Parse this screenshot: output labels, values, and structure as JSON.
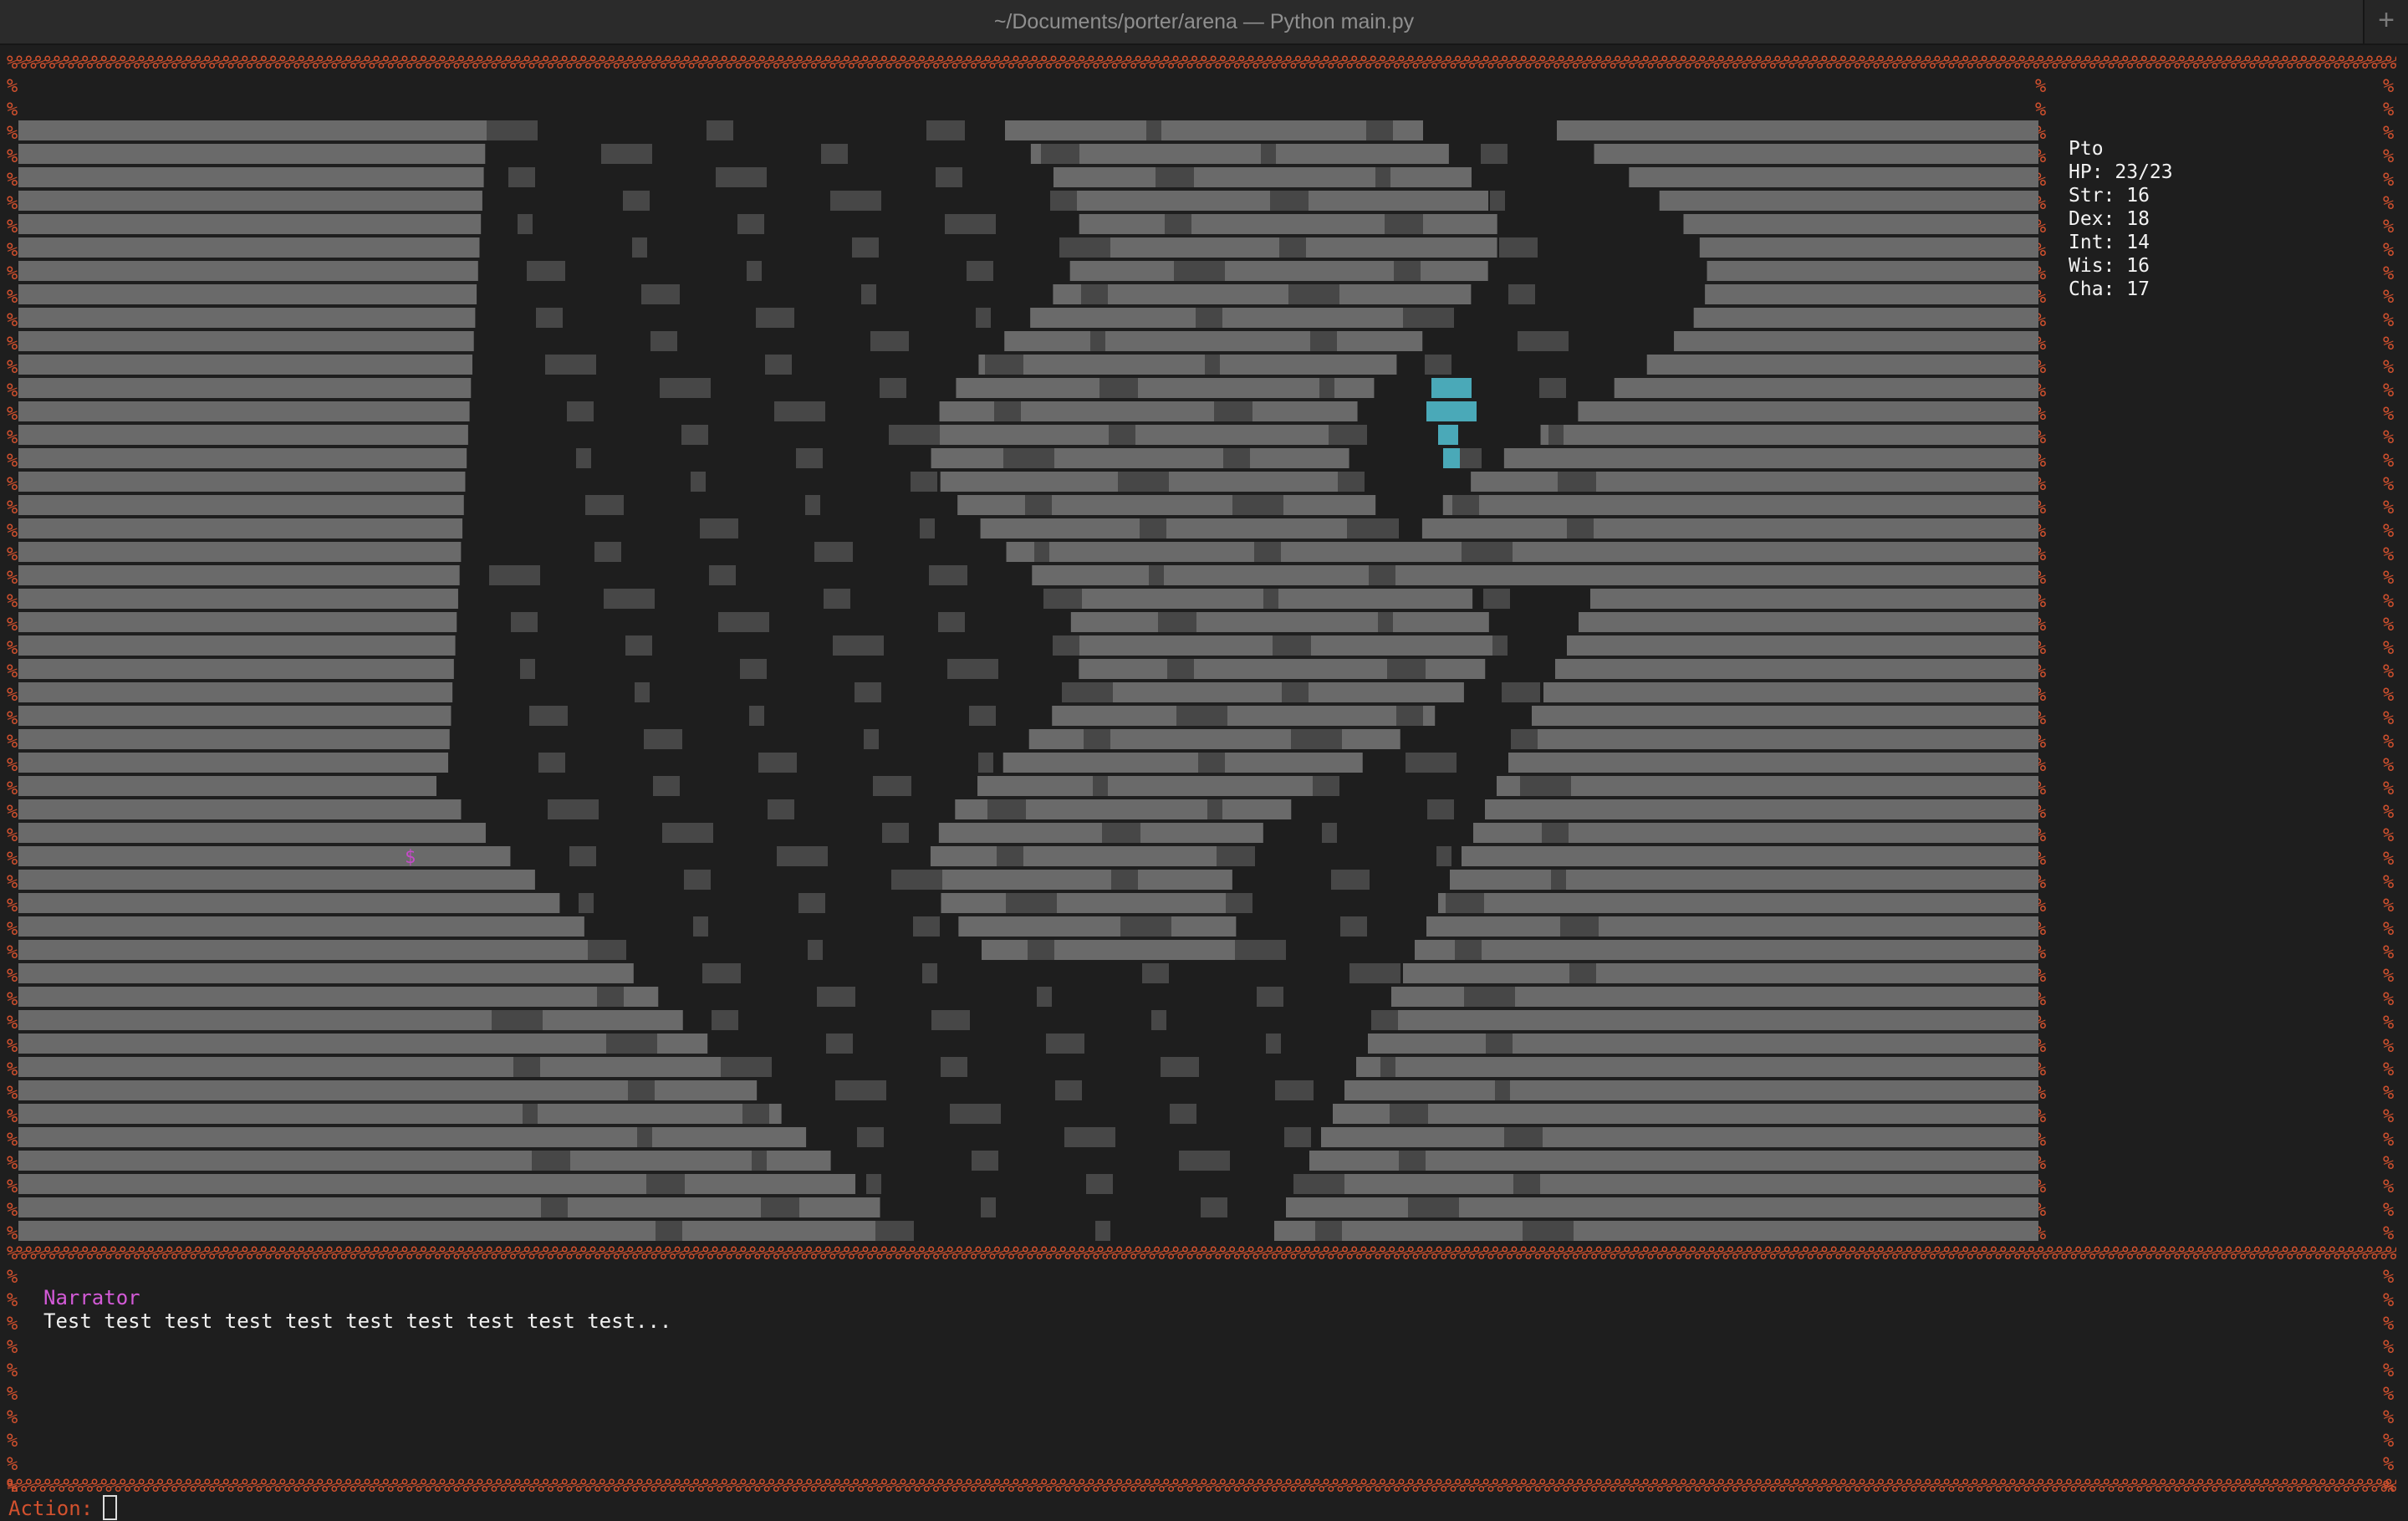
{
  "window": {
    "title": "~/Documents/porter/arena — Python main.py",
    "new_tab_symbol": "+"
  },
  "border": {
    "glyph": "%",
    "color": "#d2512e"
  },
  "map": {
    "wall_color": "#6a6a6a",
    "rubble_color": "#474747",
    "player": {
      "glyph": "$",
      "color": "#c54bc8"
    },
    "highlight_color": "#4aa9b8"
  },
  "stats": {
    "name": "Pto",
    "hp": "HP: 23/23",
    "str": "Str: 16",
    "dex": "Dex: 18",
    "int": "Int: 14",
    "wis": "Wis: 16",
    "cha": "Cha: 17"
  },
  "log": {
    "speaker": "Narrator",
    "message": "Test test test test test test test test test test..."
  },
  "prompt": {
    "label": "Action:"
  }
}
